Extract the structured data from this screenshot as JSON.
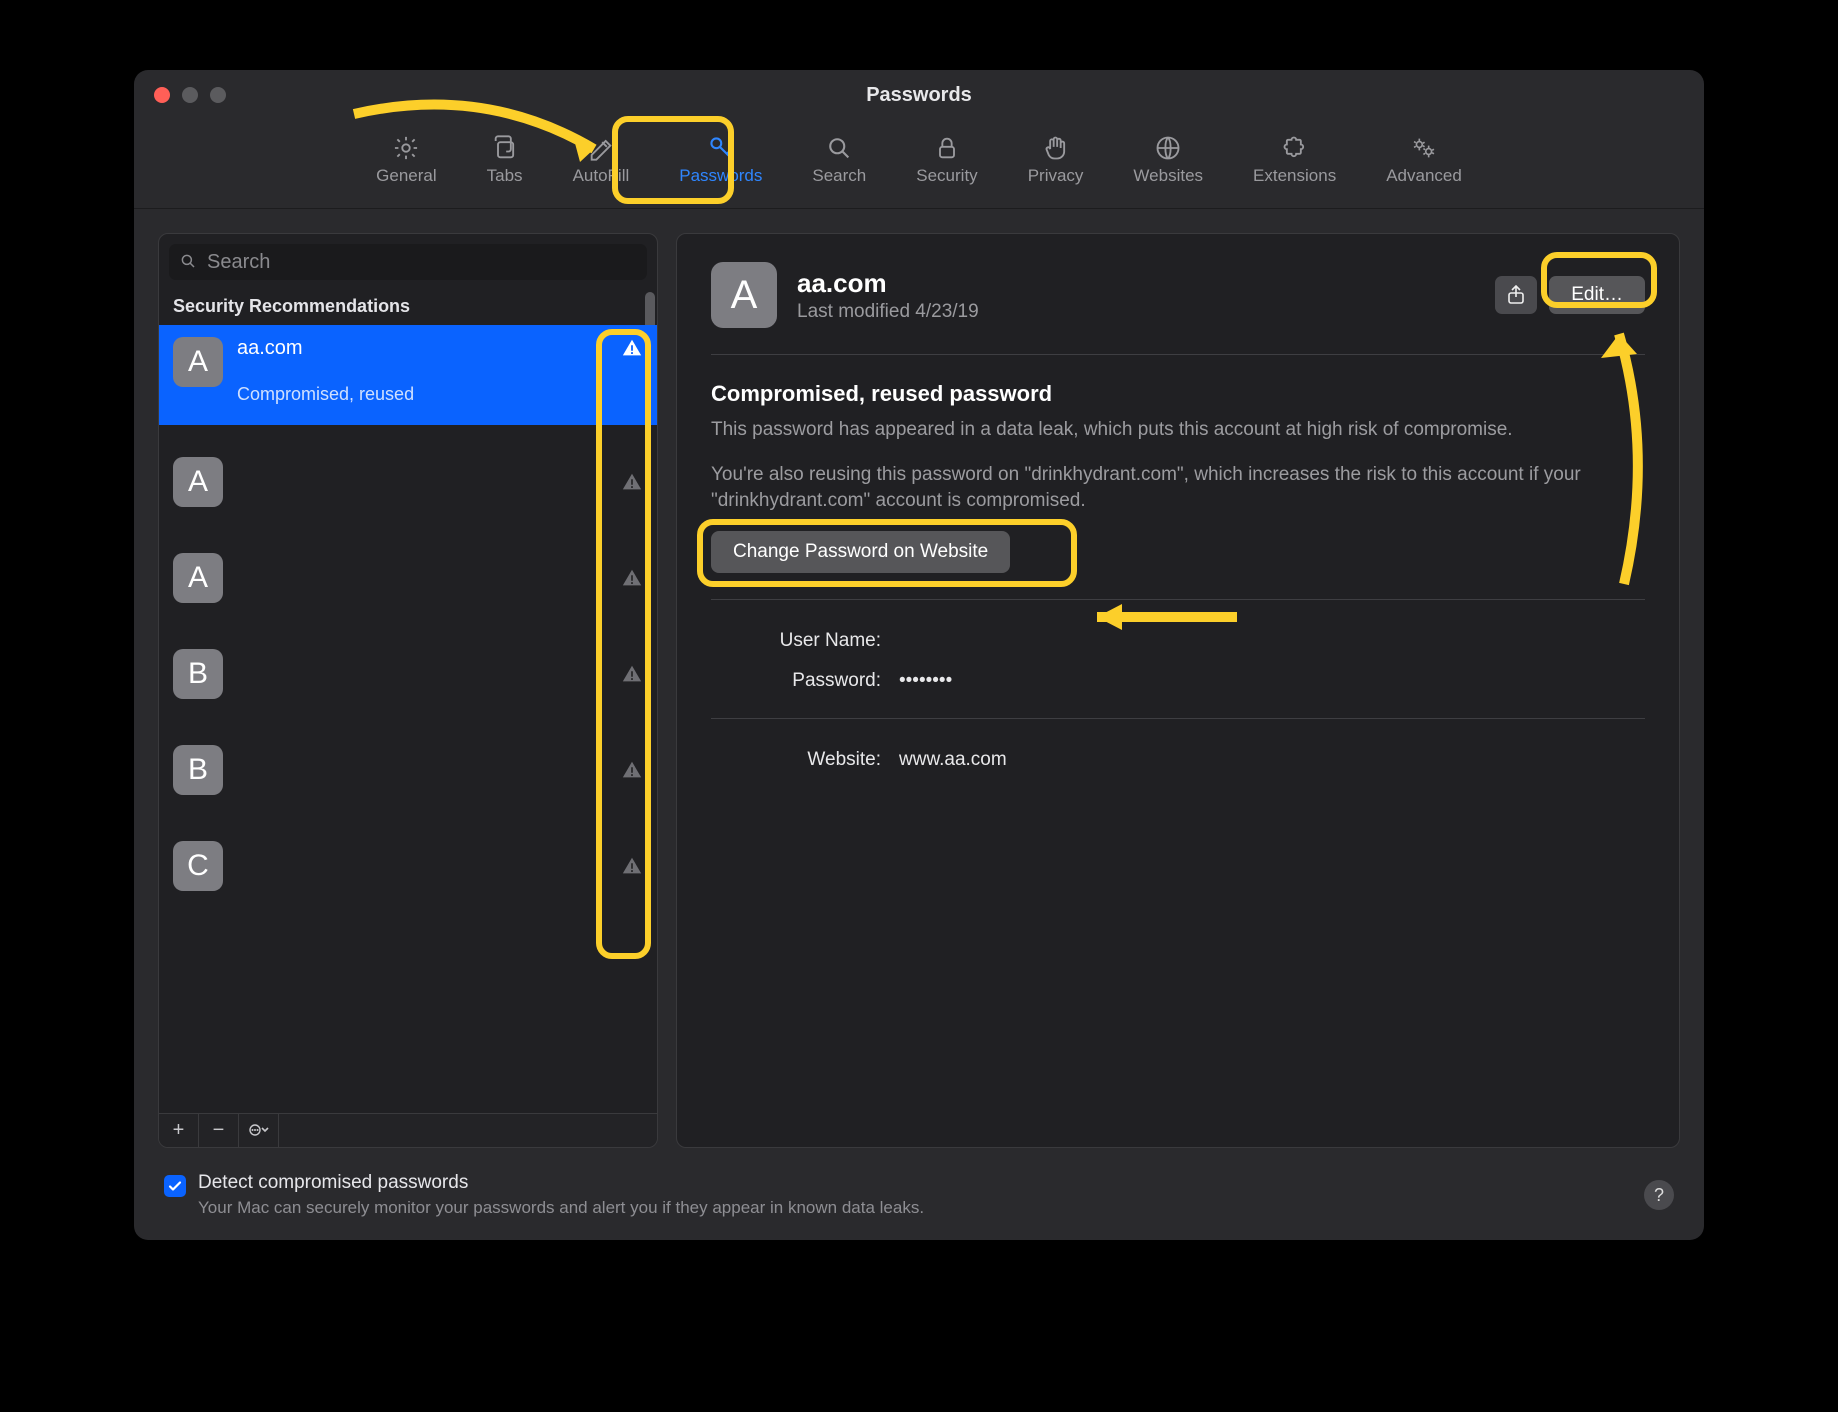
{
  "window": {
    "title": "Passwords"
  },
  "toolbar": {
    "items": [
      {
        "label": "General"
      },
      {
        "label": "Tabs"
      },
      {
        "label": "AutoFill"
      },
      {
        "label": "Passwords"
      },
      {
        "label": "Search"
      },
      {
        "label": "Security"
      },
      {
        "label": "Privacy"
      },
      {
        "label": "Websites"
      },
      {
        "label": "Extensions"
      },
      {
        "label": "Advanced"
      }
    ],
    "active_index": 3
  },
  "sidebar": {
    "search_placeholder": "Search",
    "section_header": "Security Recommendations",
    "items": [
      {
        "letter": "A",
        "title": "aa.com",
        "subtitle": "Compromised, reused",
        "selected": true
      },
      {
        "letter": "A",
        "title": "",
        "subtitle": ""
      },
      {
        "letter": "A",
        "title": "",
        "subtitle": ""
      },
      {
        "letter": "B",
        "title": "",
        "subtitle": ""
      },
      {
        "letter": "B",
        "title": "",
        "subtitle": ""
      },
      {
        "letter": "C",
        "title": "",
        "subtitle": ""
      }
    ],
    "footer": {
      "add": "+",
      "remove": "−",
      "more": "⊙⌄"
    }
  },
  "detail": {
    "avatar_letter": "A",
    "title": "aa.com",
    "subtitle": "Last modified 4/23/19",
    "edit_label": "Edit…",
    "warning_heading": "Compromised, reused password",
    "warning_text_1": "This password has appeared in a data leak, which puts this account at high risk of compromise.",
    "warning_text_2": "You're also reusing this password on \"drinkhydrant.com\", which increases the risk to this account if your \"drinkhydrant.com\" account is compromised.",
    "change_button": "Change Password on Website",
    "fields": {
      "username_label": "User Name:",
      "username_value": "",
      "password_label": "Password:",
      "password_value": "••••••••",
      "website_label": "Website:",
      "website_value": "www.aa.com"
    }
  },
  "bottom": {
    "checkbox_label": "Detect compromised passwords",
    "checkbox_sub": "Your Mac can securely monitor your passwords and alert you if they appear in known data leaks.",
    "help": "?"
  }
}
